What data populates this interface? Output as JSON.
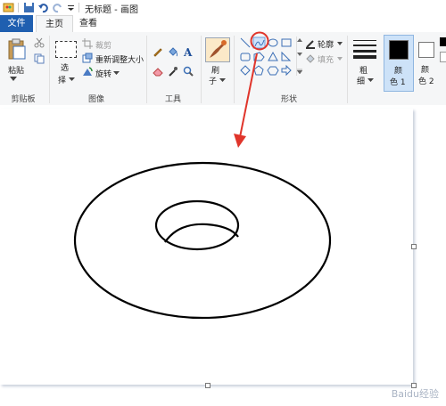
{
  "window": {
    "title": "无标题 - 画图"
  },
  "tabs": [
    {
      "label": "文件"
    },
    {
      "label": "主页"
    },
    {
      "label": "查看"
    }
  ],
  "clipboard": {
    "paste_label": "粘贴",
    "group_label": "剪贴板"
  },
  "image": {
    "select_label": "选",
    "select_label2": "择",
    "crop_label": "裁剪",
    "resize_label": "重新调整大小",
    "rotate_label": "旋转",
    "group_label": "图像"
  },
  "tools": {
    "brush_label": "刷",
    "brush_label2": "子",
    "group_label": "工具"
  },
  "shapes": {
    "outline_label": "轮廓",
    "fill_label": "填充",
    "group_label": "形状"
  },
  "size": {
    "label": "粗",
    "label2": "细"
  },
  "colors": {
    "color1_label": "颜",
    "color1_label2": "色 1",
    "color2_label": "颜",
    "color2_label2": "色 2",
    "color1": "#000000",
    "color2": "#ffffff"
  },
  "accent": {
    "file_tab": "#1f5fb0",
    "highlight_circle": "#e0352b"
  },
  "watermark": "Baidu经验"
}
